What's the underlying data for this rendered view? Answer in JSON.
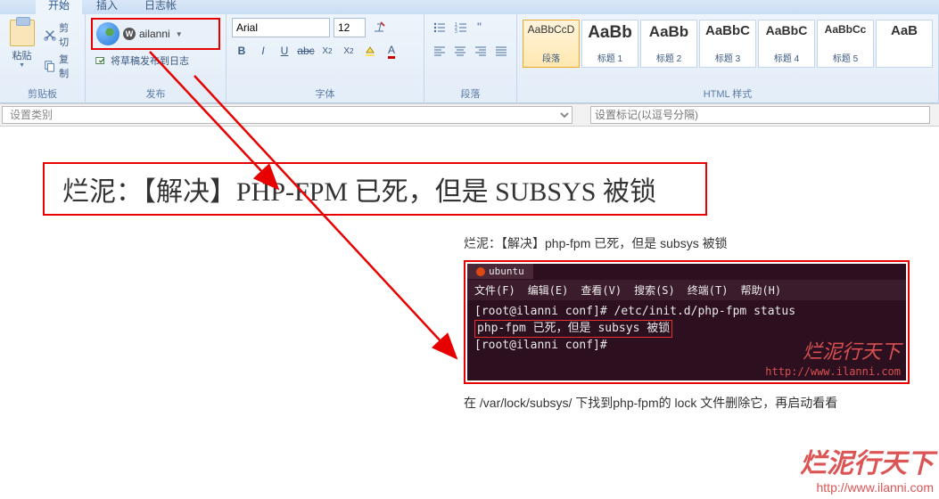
{
  "tabs": {
    "start": "开始",
    "insert": "插入",
    "other": "日志帐"
  },
  "clipboard": {
    "paste": "粘贴",
    "cut": "剪切",
    "copy": "复制",
    "group": "剪贴板"
  },
  "publish": {
    "account": "ailanni",
    "publish_btn": "将草稿发布到日志",
    "group": "发布"
  },
  "font": {
    "name": "Arial",
    "size": "12",
    "group": "字体"
  },
  "paragraph": {
    "group": "段落"
  },
  "styles": {
    "group": "HTML 样式",
    "items": [
      {
        "preview": "AaBbCcD",
        "label": "段落",
        "size": "12px"
      },
      {
        "preview": "AaBb",
        "label": "标题 1",
        "size": "19px"
      },
      {
        "preview": "AaBb",
        "label": "标题 2",
        "size": "17px"
      },
      {
        "preview": "AaBbC",
        "label": "标题 3",
        "size": "15px"
      },
      {
        "preview": "AaBbC",
        "label": "标题 4",
        "size": "14px"
      },
      {
        "preview": "AaBbCc",
        "label": "标题 5",
        "size": "12px"
      },
      {
        "preview": "AaB",
        "label": "",
        "size": "15px"
      }
    ]
  },
  "catbar": {
    "category_placeholder": "设置类别",
    "tags_placeholder": "设置标记(以逗号分隔)"
  },
  "doc": {
    "title": "烂泥：【解决】PHP-FPM 已死，但是 SUBSYS 被锁",
    "body_line": "烂泥：【解决】php-fpm 已死，但是 subsys 被锁",
    "body_line2": "在 /var/lock/subsys/ 下找到php-fpm的 lock 文件删除它，再启动看看"
  },
  "terminal": {
    "tab": "ubuntu",
    "menu": {
      "file": "文件(F)",
      "edit": "编辑(E)",
      "view": "查看(V)",
      "search": "搜索(S)",
      "term": "终端(T)",
      "help": "帮助(H)"
    },
    "line1": "[root@ilanni conf]# /etc/init.d/php-fpm status",
    "line2": "php-fpm 已死，但是 subsys 被锁",
    "line3": "[root@ilanni conf]#",
    "watermark_cn": "烂泥行天下",
    "watermark_url": "http://www.ilanni.com"
  },
  "page_watermark": {
    "cn": "烂泥行天下",
    "url": "http://www.ilanni.com"
  }
}
